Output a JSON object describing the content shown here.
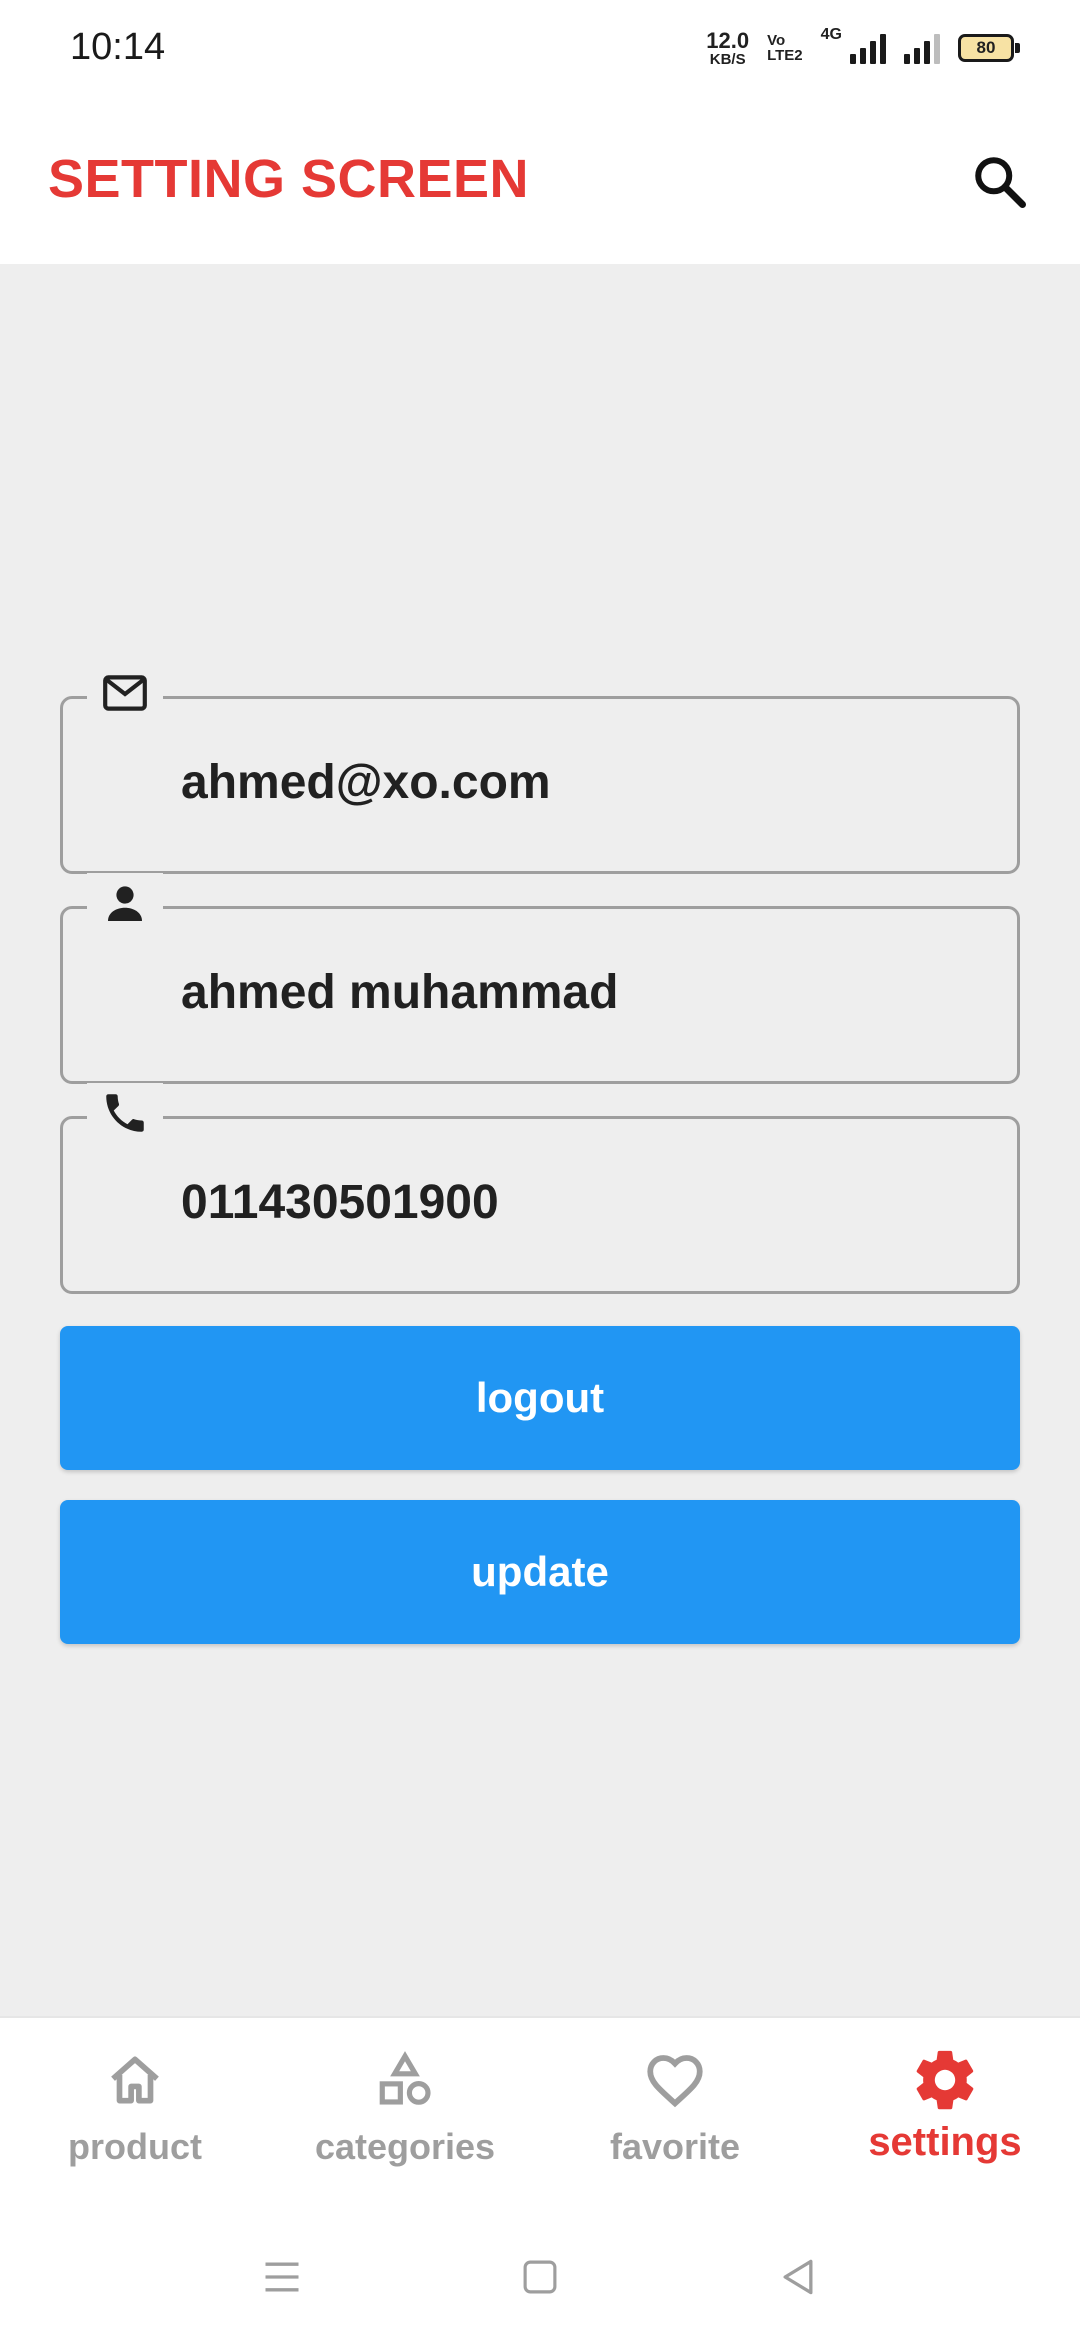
{
  "status_bar": {
    "time": "10:14",
    "net_speed_value": "12.0",
    "net_speed_unit": "KB/S",
    "volte_top": "Vo",
    "volte_bottom": "LTE2",
    "network_type": "4G",
    "battery": "80"
  },
  "app_bar": {
    "title": "SETTING SCREEN",
    "search_icon": "search-icon"
  },
  "form": {
    "email": {
      "icon": "mail-icon",
      "value": "ahmed@xo.com"
    },
    "name": {
      "icon": "person-icon",
      "value": "ahmed muhammad"
    },
    "phone": {
      "icon": "phone-icon",
      "value": "011430501900"
    }
  },
  "buttons": {
    "logout_label": "logout",
    "update_label": "update"
  },
  "bottom_nav": {
    "items": [
      {
        "label": "product",
        "icon": "home-icon",
        "active": false
      },
      {
        "label": "categories",
        "icon": "shapes-icon",
        "active": false
      },
      {
        "label": "favorite",
        "icon": "heart-icon",
        "active": false
      },
      {
        "label": "settings",
        "icon": "gear-icon",
        "active": true
      }
    ]
  },
  "colors": {
    "accent_red": "#e53935",
    "button_blue": "#2196f3",
    "content_bg": "#eeeeee",
    "inactive_gray": "#9e9e9e"
  }
}
